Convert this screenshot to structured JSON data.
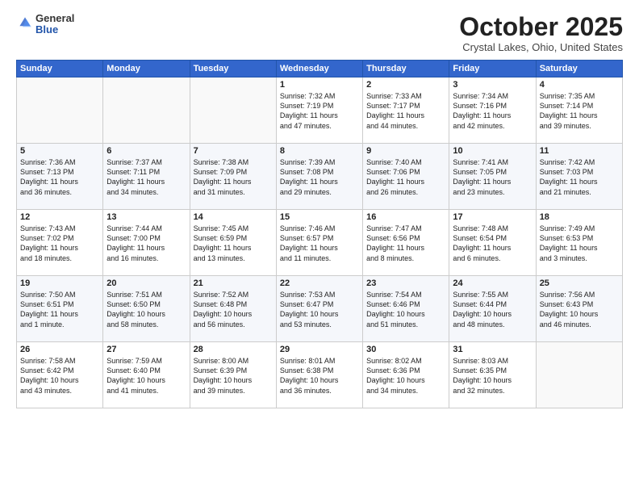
{
  "header": {
    "logo_line1": "General",
    "logo_line2": "Blue",
    "month": "October 2025",
    "location": "Crystal Lakes, Ohio, United States"
  },
  "weekdays": [
    "Sunday",
    "Monday",
    "Tuesday",
    "Wednesday",
    "Thursday",
    "Friday",
    "Saturday"
  ],
  "weeks": [
    [
      {
        "day": "",
        "info": ""
      },
      {
        "day": "",
        "info": ""
      },
      {
        "day": "",
        "info": ""
      },
      {
        "day": "1",
        "info": "Sunrise: 7:32 AM\nSunset: 7:19 PM\nDaylight: 11 hours\nand 47 minutes."
      },
      {
        "day": "2",
        "info": "Sunrise: 7:33 AM\nSunset: 7:17 PM\nDaylight: 11 hours\nand 44 minutes."
      },
      {
        "day": "3",
        "info": "Sunrise: 7:34 AM\nSunset: 7:16 PM\nDaylight: 11 hours\nand 42 minutes."
      },
      {
        "day": "4",
        "info": "Sunrise: 7:35 AM\nSunset: 7:14 PM\nDaylight: 11 hours\nand 39 minutes."
      }
    ],
    [
      {
        "day": "5",
        "info": "Sunrise: 7:36 AM\nSunset: 7:13 PM\nDaylight: 11 hours\nand 36 minutes."
      },
      {
        "day": "6",
        "info": "Sunrise: 7:37 AM\nSunset: 7:11 PM\nDaylight: 11 hours\nand 34 minutes."
      },
      {
        "day": "7",
        "info": "Sunrise: 7:38 AM\nSunset: 7:09 PM\nDaylight: 11 hours\nand 31 minutes."
      },
      {
        "day": "8",
        "info": "Sunrise: 7:39 AM\nSunset: 7:08 PM\nDaylight: 11 hours\nand 29 minutes."
      },
      {
        "day": "9",
        "info": "Sunrise: 7:40 AM\nSunset: 7:06 PM\nDaylight: 11 hours\nand 26 minutes."
      },
      {
        "day": "10",
        "info": "Sunrise: 7:41 AM\nSunset: 7:05 PM\nDaylight: 11 hours\nand 23 minutes."
      },
      {
        "day": "11",
        "info": "Sunrise: 7:42 AM\nSunset: 7:03 PM\nDaylight: 11 hours\nand 21 minutes."
      }
    ],
    [
      {
        "day": "12",
        "info": "Sunrise: 7:43 AM\nSunset: 7:02 PM\nDaylight: 11 hours\nand 18 minutes."
      },
      {
        "day": "13",
        "info": "Sunrise: 7:44 AM\nSunset: 7:00 PM\nDaylight: 11 hours\nand 16 minutes."
      },
      {
        "day": "14",
        "info": "Sunrise: 7:45 AM\nSunset: 6:59 PM\nDaylight: 11 hours\nand 13 minutes."
      },
      {
        "day": "15",
        "info": "Sunrise: 7:46 AM\nSunset: 6:57 PM\nDaylight: 11 hours\nand 11 minutes."
      },
      {
        "day": "16",
        "info": "Sunrise: 7:47 AM\nSunset: 6:56 PM\nDaylight: 11 hours\nand 8 minutes."
      },
      {
        "day": "17",
        "info": "Sunrise: 7:48 AM\nSunset: 6:54 PM\nDaylight: 11 hours\nand 6 minutes."
      },
      {
        "day": "18",
        "info": "Sunrise: 7:49 AM\nSunset: 6:53 PM\nDaylight: 11 hours\nand 3 minutes."
      }
    ],
    [
      {
        "day": "19",
        "info": "Sunrise: 7:50 AM\nSunset: 6:51 PM\nDaylight: 11 hours\nand 1 minute."
      },
      {
        "day": "20",
        "info": "Sunrise: 7:51 AM\nSunset: 6:50 PM\nDaylight: 10 hours\nand 58 minutes."
      },
      {
        "day": "21",
        "info": "Sunrise: 7:52 AM\nSunset: 6:48 PM\nDaylight: 10 hours\nand 56 minutes."
      },
      {
        "day": "22",
        "info": "Sunrise: 7:53 AM\nSunset: 6:47 PM\nDaylight: 10 hours\nand 53 minutes."
      },
      {
        "day": "23",
        "info": "Sunrise: 7:54 AM\nSunset: 6:46 PM\nDaylight: 10 hours\nand 51 minutes."
      },
      {
        "day": "24",
        "info": "Sunrise: 7:55 AM\nSunset: 6:44 PM\nDaylight: 10 hours\nand 48 minutes."
      },
      {
        "day": "25",
        "info": "Sunrise: 7:56 AM\nSunset: 6:43 PM\nDaylight: 10 hours\nand 46 minutes."
      }
    ],
    [
      {
        "day": "26",
        "info": "Sunrise: 7:58 AM\nSunset: 6:42 PM\nDaylight: 10 hours\nand 43 minutes."
      },
      {
        "day": "27",
        "info": "Sunrise: 7:59 AM\nSunset: 6:40 PM\nDaylight: 10 hours\nand 41 minutes."
      },
      {
        "day": "28",
        "info": "Sunrise: 8:00 AM\nSunset: 6:39 PM\nDaylight: 10 hours\nand 39 minutes."
      },
      {
        "day": "29",
        "info": "Sunrise: 8:01 AM\nSunset: 6:38 PM\nDaylight: 10 hours\nand 36 minutes."
      },
      {
        "day": "30",
        "info": "Sunrise: 8:02 AM\nSunset: 6:36 PM\nDaylight: 10 hours\nand 34 minutes."
      },
      {
        "day": "31",
        "info": "Sunrise: 8:03 AM\nSunset: 6:35 PM\nDaylight: 10 hours\nand 32 minutes."
      },
      {
        "day": "",
        "info": ""
      }
    ]
  ]
}
